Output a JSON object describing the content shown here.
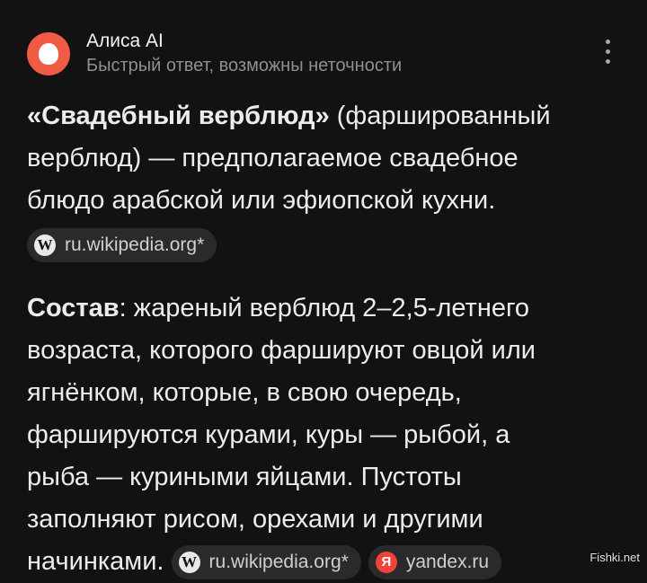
{
  "header": {
    "app_name": "Алиса AI",
    "subtitle": "Быстрый ответ, возможны неточности"
  },
  "answer": {
    "p1_lines": [
      "«Свадебный верблюд» (фаршированный",
      "верблюд) — предполагаемое свадебное",
      "блюдо арабской или эфиопской кухни."
    ],
    "p1_bold": "«Свадебный верблюд»",
    "p1_line1_rest": " (фаршированный",
    "p1_line2": "верблюд) — предполагаемое свадебное",
    "p1_line3": "блюдо арабской или эфиопской кухни.",
    "source1": "ru.wikipedia.org*",
    "p2_bold": "Состав",
    "p2_line1_rest": ": жареный верблюд 2–2,5-летнего",
    "p2_line2": "возраста, которого фаршируют овцой или",
    "p2_line3": "ягнёнком, которые, в свою очередь,",
    "p2_line4": "фаршируются курами, куры — рыбой, а",
    "p2_line5": "рыба — куриными яйцами. Пустоты",
    "p2_line6": "заполняют рисом, орехами и другими",
    "p2_line7": "начинками.",
    "source2": "ru.wikipedia.org*",
    "source3": "yandex.ru"
  },
  "icons": {
    "wiki_glyph": "W",
    "yandex_glyph": "Я"
  },
  "watermark": "Fishki.net",
  "colors": {
    "background": "#121212",
    "avatar": "#f25b43",
    "chip": "#2a2a2a",
    "yandex": "#f0443a"
  }
}
